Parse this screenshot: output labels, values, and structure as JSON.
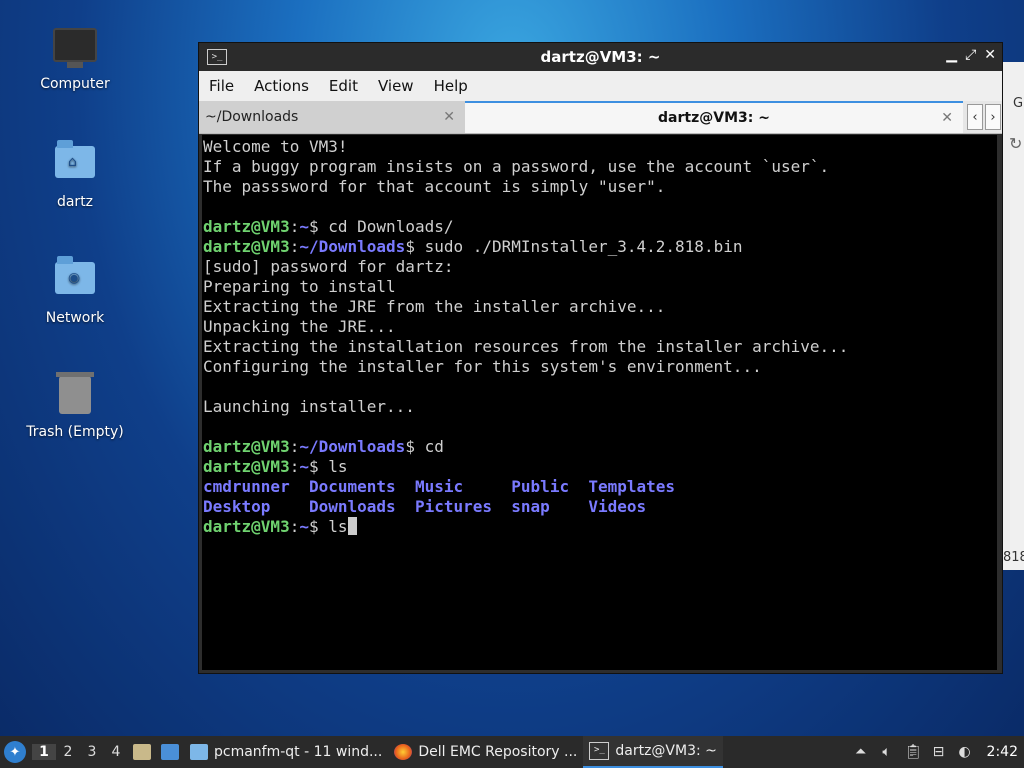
{
  "desktop": {
    "icons": [
      {
        "label": "Computer",
        "icon": "computer-icon"
      },
      {
        "label": "dartz",
        "icon": "home-folder-icon"
      },
      {
        "label": "Network",
        "icon": "network-folder-icon"
      },
      {
        "label": "Trash (Empty)",
        "icon": "trash-icon"
      }
    ]
  },
  "background_window": {
    "top_letter": "G",
    "bottom_text": "818"
  },
  "terminal": {
    "title": "dartz@VM3: ~",
    "menu": [
      "File",
      "Actions",
      "Edit",
      "View",
      "Help"
    ],
    "tabs": [
      {
        "label": "~/Downloads",
        "active": false
      },
      {
        "label": "dartz@VM3: ~",
        "active": true
      }
    ],
    "lines": [
      {
        "text": "Welcome to VM3!"
      },
      {
        "text": "If a buggy program insists on a password, use the account `user`."
      },
      {
        "text": "The passsword for that account is simply \"user\"."
      },
      {
        "text": ""
      },
      {
        "user": "dartz@VM3",
        "path": "~",
        "cmd": " cd Downloads/"
      },
      {
        "user": "dartz@VM3",
        "path": "~/Downloads",
        "cmd": " sudo ./DRMInstaller_3.4.2.818.bin"
      },
      {
        "text": "[sudo] password for dartz:"
      },
      {
        "text": "Preparing to install"
      },
      {
        "text": "Extracting the JRE from the installer archive..."
      },
      {
        "text": "Unpacking the JRE..."
      },
      {
        "text": "Extracting the installation resources from the installer archive..."
      },
      {
        "text": "Configuring the installer for this system's environment..."
      },
      {
        "text": ""
      },
      {
        "text": "Launching installer..."
      },
      {
        "text": ""
      },
      {
        "user": "dartz@VM3",
        "path": "~/Downloads",
        "cmd": " cd"
      },
      {
        "user": "dartz@VM3",
        "path": "~",
        "cmd": " ls"
      },
      {
        "dirs": [
          "cmdrunner",
          "Documents",
          "Music",
          "Public",
          "Templates"
        ]
      },
      {
        "dirs": [
          "Desktop",
          "Downloads",
          "Pictures",
          "snap",
          "Videos"
        ]
      },
      {
        "user": "dartz@VM3",
        "path": "~",
        "cmd": " ls",
        "cursor": true
      }
    ]
  },
  "taskbar": {
    "workspaces": [
      "1",
      "2",
      "3",
      "4"
    ],
    "active_workspace": "1",
    "tasks": [
      {
        "label": "pcmanfm-qt - 11 wind...",
        "icon": "folder-icon",
        "active": false
      },
      {
        "label": "Dell EMC Repository ...",
        "icon": "firefox-icon",
        "active": false
      },
      {
        "label": "dartz@VM3: ~",
        "icon": "terminal-icon",
        "active": true
      }
    ],
    "clock": "2:42"
  }
}
